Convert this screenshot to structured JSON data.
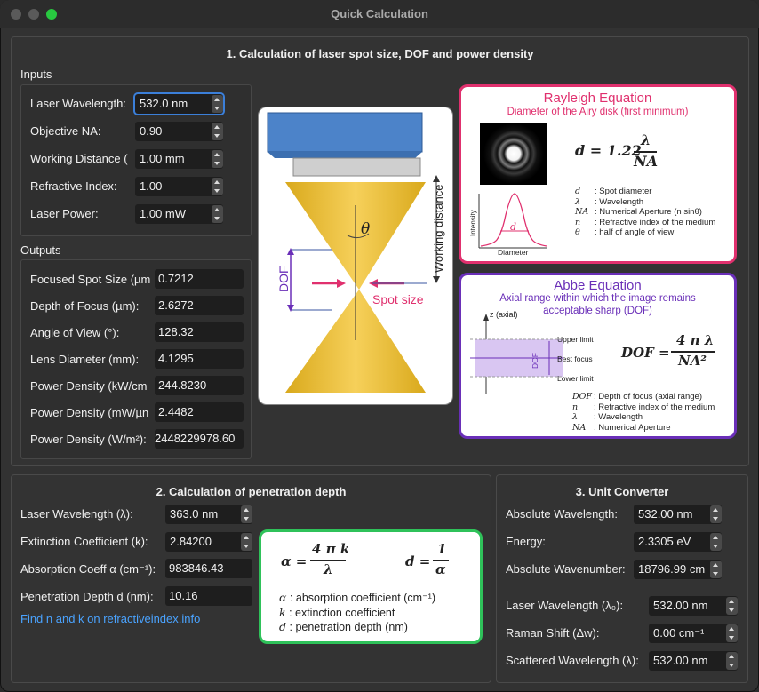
{
  "window": {
    "title": "Quick Calculation"
  },
  "section1": {
    "title": "1. Calculation of laser spot size, DOF and power density",
    "inputs_title": "Inputs",
    "outputs_title": "Outputs",
    "inputs": [
      {
        "label": "Laser Wavelength:",
        "value": "532.0 nm"
      },
      {
        "label": "Objective NA:",
        "value": "0.90"
      },
      {
        "label": "Working Distance (",
        "value": "1.00 mm"
      },
      {
        "label": "Refractive Index:",
        "value": "1.00"
      },
      {
        "label": "Laser Power:",
        "value": "1.00 mW"
      }
    ],
    "outputs": [
      {
        "label": "Focused Spot Size (µm",
        "value": "0.7212"
      },
      {
        "label": "Depth of Focus (µm):",
        "value": "2.6272"
      },
      {
        "label": "Angle of View (°):",
        "value": "128.32"
      },
      {
        "label": "Lens Diameter (mm):",
        "value": "4.1295"
      },
      {
        "label": "Power Density (kW/cm",
        "value": "244.8230"
      },
      {
        "label": "Power Density (mW/µn",
        "value": "2.4482"
      },
      {
        "label": "Power Density (W/m²):",
        "value": "2448229978.60"
      }
    ],
    "diagram": {
      "theta": "θ",
      "working_distance": "Working distance",
      "dof": "DOF",
      "spot_size": "Spot size"
    },
    "rayleigh": {
      "title": "Rayleigh Equation",
      "subtitle": "Diameter of the Airy disk (first minimum)",
      "formula_lhs": "d = 1.22",
      "num": "λ",
      "den": "NA",
      "axis_y": "Intensity",
      "axis_x": "Diameter",
      "plot_d": "d",
      "legend": [
        {
          "sym": "d",
          "text": ": Spot diameter"
        },
        {
          "sym": "λ",
          "text": ": Wavelength"
        },
        {
          "sym": "NA",
          "text": ": Numerical Aperture (n sinθ)"
        },
        {
          "sym": "n",
          "text": ": Refractive index of the medium"
        },
        {
          "sym": "θ",
          "text": ": half of angle of view"
        }
      ]
    },
    "abbe": {
      "title": "Abbe Equation",
      "subtitle1": "Axial range within which the image remains",
      "subtitle2": "acceptable sharp (DOF)",
      "axis": "z (axial)",
      "upper": "Upper limit",
      "best": "Best focus",
      "lower": "Lower limit",
      "dof": "DOF",
      "formula_lhs": "DOF =",
      "num": "4 n λ",
      "den": "NA²",
      "legend": [
        {
          "sym": "DOF",
          "text": ": Depth of focus (axial range)"
        },
        {
          "sym": "n",
          "text": ": Refractive index of the medium"
        },
        {
          "sym": "λ",
          "text": ": Wavelength"
        },
        {
          "sym": "NA",
          "text": ": Numerical Aperture"
        }
      ]
    }
  },
  "section2": {
    "title": "2. Calculation of penetration depth",
    "fields": [
      {
        "label": "Laser Wavelength (λ):",
        "value": "363.0 nm",
        "spin": true
      },
      {
        "label": "Extinction Coefficient (k):",
        "value": "2.84200",
        "spin": true
      },
      {
        "label": "Absorption Coeff α (cm⁻¹):",
        "value": "983846.43",
        "spin": false
      },
      {
        "label": "Penetration Depth d (nm):",
        "value": "10.16",
        "spin": false
      }
    ],
    "link": "Find n and k on refractiveindex.info",
    "formula": {
      "alpha_lhs": "α =",
      "alpha_num": "4 π k",
      "alpha_den": "λ",
      "d_lhs": "d =",
      "d_num": "1",
      "d_den": "α",
      "legend": [
        {
          "sym": "α",
          "text": ": absorption coefficient (cm⁻¹)"
        },
        {
          "sym": "k",
          "text": ": extinction coefficient"
        },
        {
          "sym": "d",
          "text": ": penetration depth (nm)"
        }
      ]
    }
  },
  "section3": {
    "title": "3. Unit Converter",
    "fields": [
      {
        "label": "Absolute Wavelength:",
        "value": "532.00 nm"
      },
      {
        "label": "Energy:",
        "value": "2.3305 eV"
      },
      {
        "label": "Absolute Wavenumber:",
        "value": "18796.99 cm"
      },
      {
        "label": "Laser Wavelength (λ₀):",
        "value": "532.00 nm"
      },
      {
        "label": "Raman Shift (Δw):",
        "value": "0.00 cm⁻¹"
      },
      {
        "label": "Scattered Wavelength (λ):",
        "value": "532.00 nm"
      }
    ]
  },
  "colors": {
    "rayleigh_border": "#e0306e",
    "abbe_border": "#6a2fb8",
    "penetration_border": "#2fc25a",
    "focus": "#3b7fd9"
  }
}
